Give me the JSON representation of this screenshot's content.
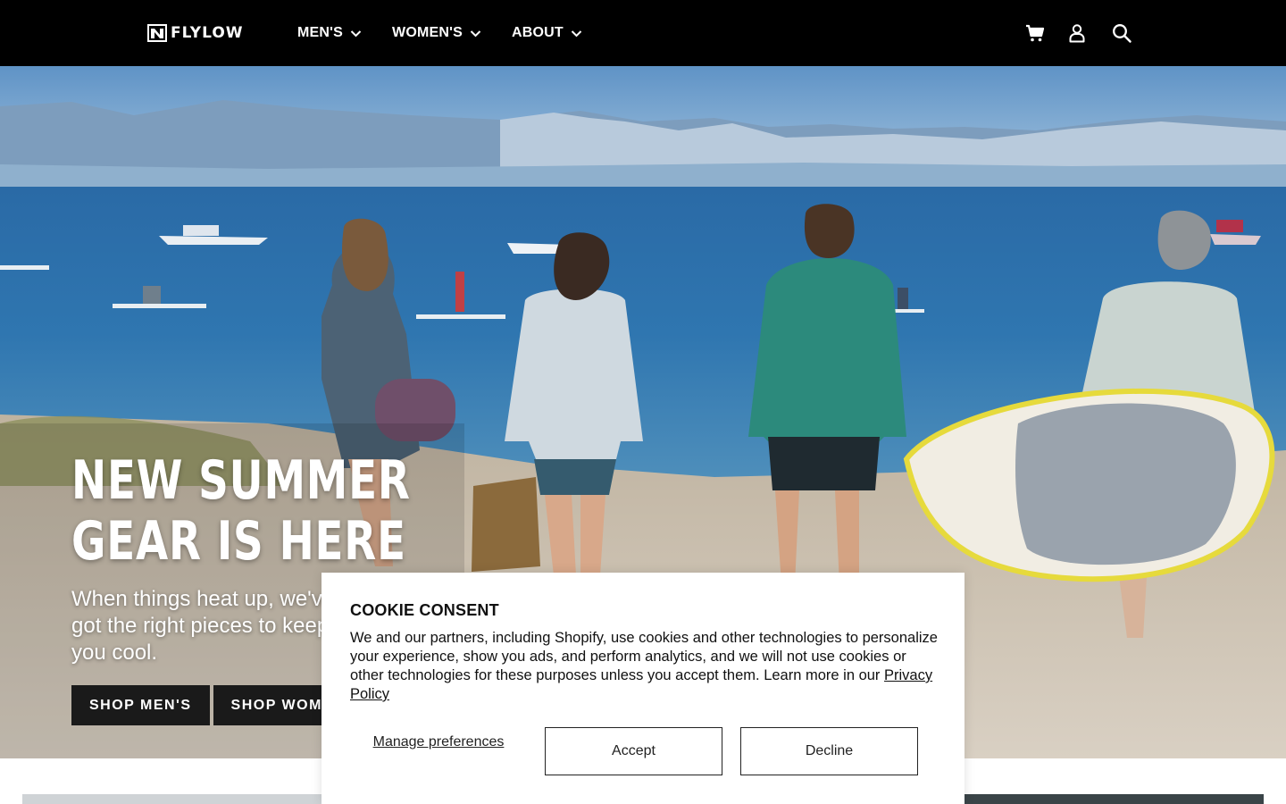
{
  "header": {
    "logo_text": "FLYLOW",
    "nav": [
      {
        "label": "MEN'S"
      },
      {
        "label": "WOMEN'S"
      },
      {
        "label": "ABOUT"
      }
    ],
    "icons": [
      "cart-icon",
      "account-icon",
      "search-icon"
    ]
  },
  "hero": {
    "title_line1": "NEW SUMMER",
    "title_line2": "GEAR IS HERE",
    "subtitle": "When things heat up, we've got the right pieces to keep you cool.",
    "buttons": [
      {
        "label": "SHOP MEN'S"
      },
      {
        "label": "SHOP WOMEN'S"
      }
    ]
  },
  "cookie": {
    "title": "COOKIE CONSENT",
    "body": "We and our partners, including Shopify, use cookies and other technologies to personalize your experience, show you ads, and perform analytics, and we will not use cookies or other technologies for these purposes unless you accept them. Learn more in our ",
    "link": "Privacy Policy",
    "manage_label": "Manage preferences",
    "accept_label": "Accept",
    "decline_label": "Decline"
  },
  "colors": {
    "header_bg": "#000000",
    "button_dark": "#1a1a1a",
    "modal_bg": "#ffffff"
  }
}
